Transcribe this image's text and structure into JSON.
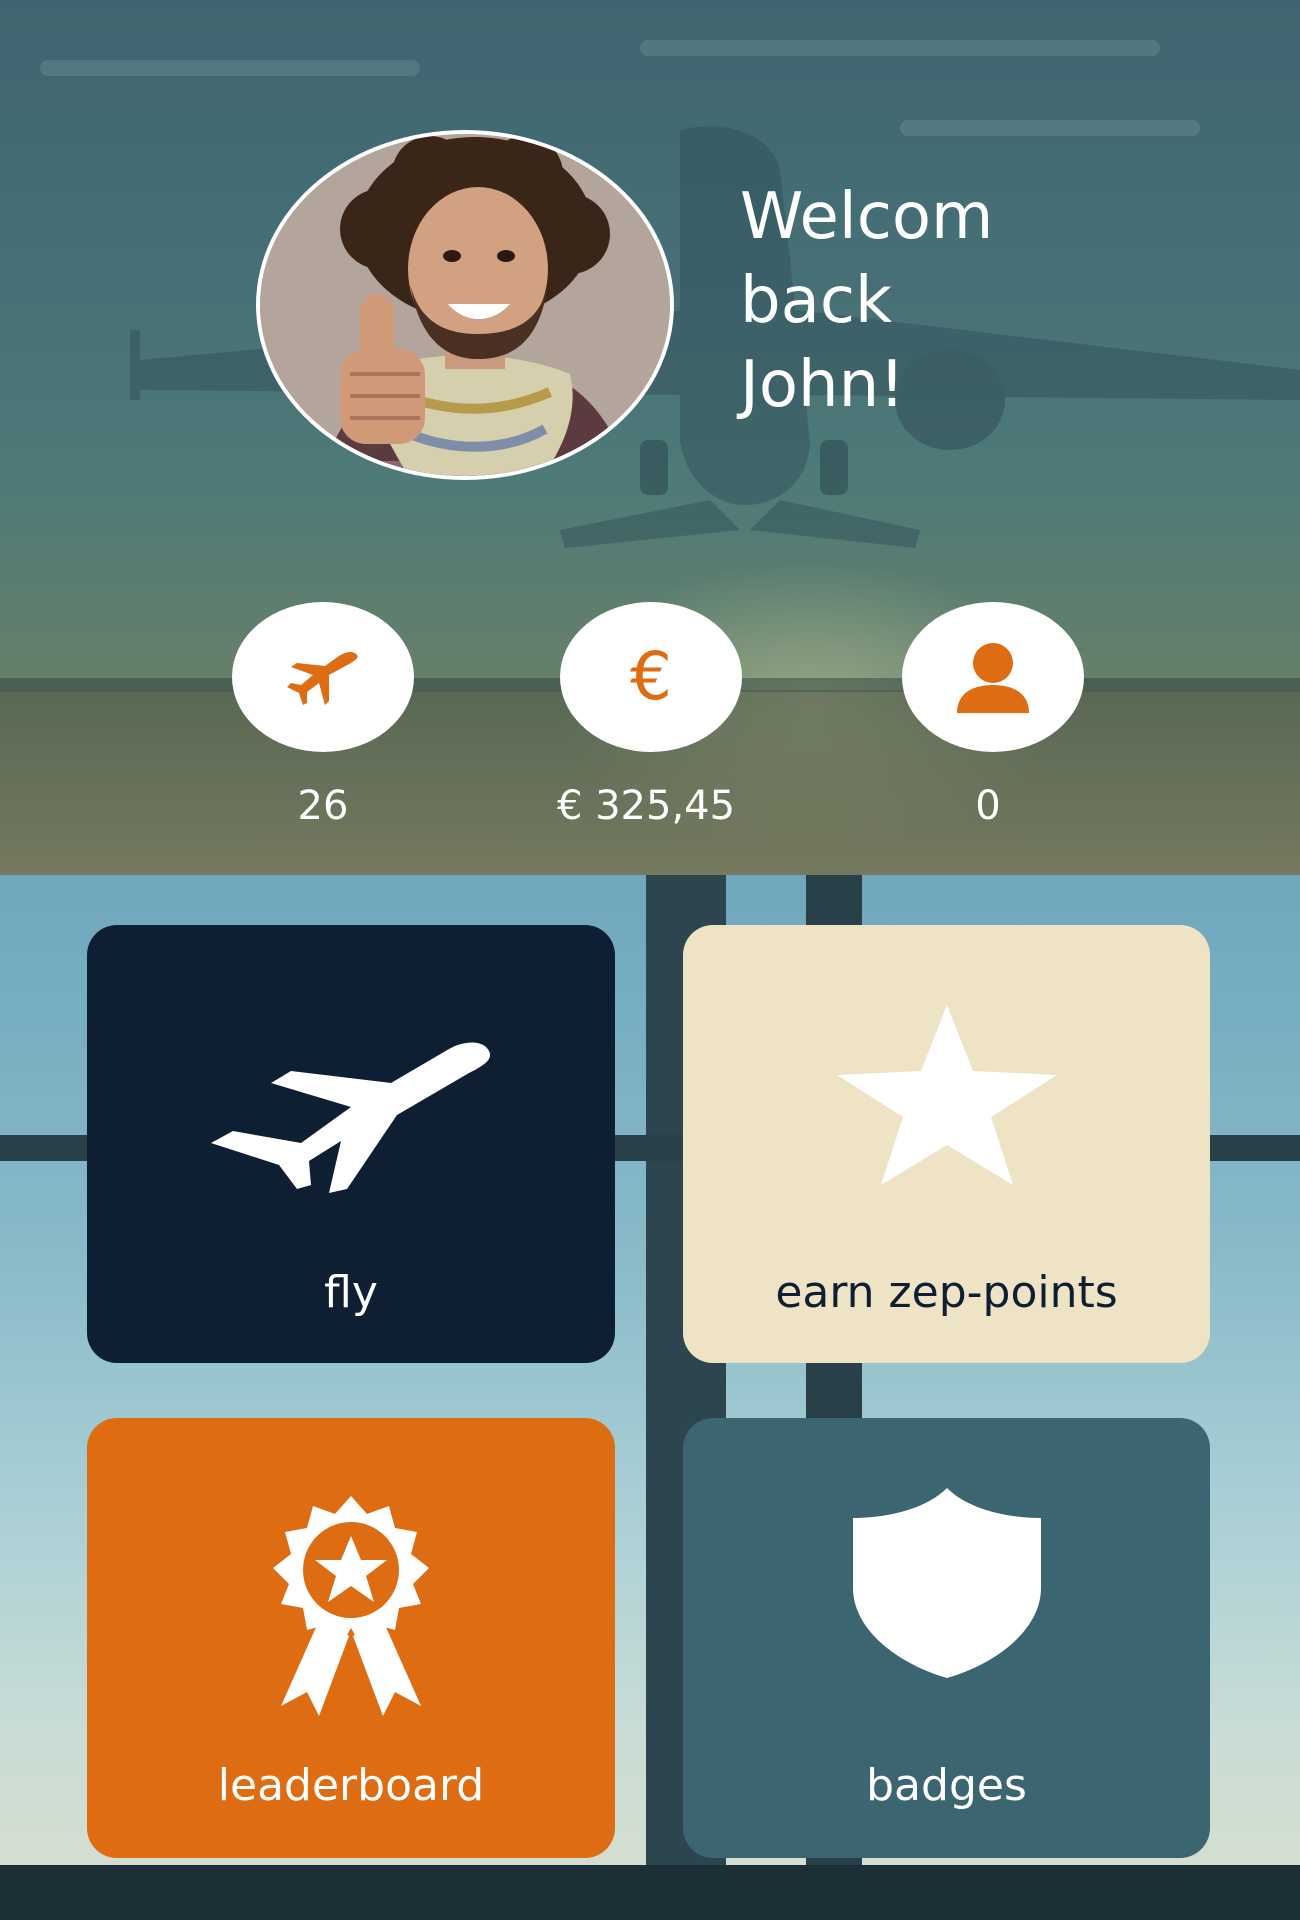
{
  "header": {
    "welcome_lines": [
      "Welcom",
      "back",
      "John!"
    ]
  },
  "stats": [
    {
      "icon": "plane-icon",
      "value": "26"
    },
    {
      "icon": "euro-icon",
      "glyph": "€",
      "value": "€ 325,45"
    },
    {
      "icon": "person-icon",
      "value": "0"
    }
  ],
  "tiles": [
    {
      "icon": "plane-icon",
      "label": "fly",
      "color": "#0e1f33"
    },
    {
      "icon": "star-icon",
      "label": "earn zep-points",
      "color": "#efe3c6"
    },
    {
      "icon": "award-ribbon-icon",
      "label": "leaderboard",
      "color": "#dd6c12"
    },
    {
      "icon": "shield-icon",
      "label": "badges",
      "color": "#3b6570"
    }
  ],
  "colors": {
    "accent": "#dd6c12",
    "navy": "#0e1f33",
    "cream": "#efe3c6",
    "teal": "#3b6570",
    "white": "#ffffff"
  }
}
